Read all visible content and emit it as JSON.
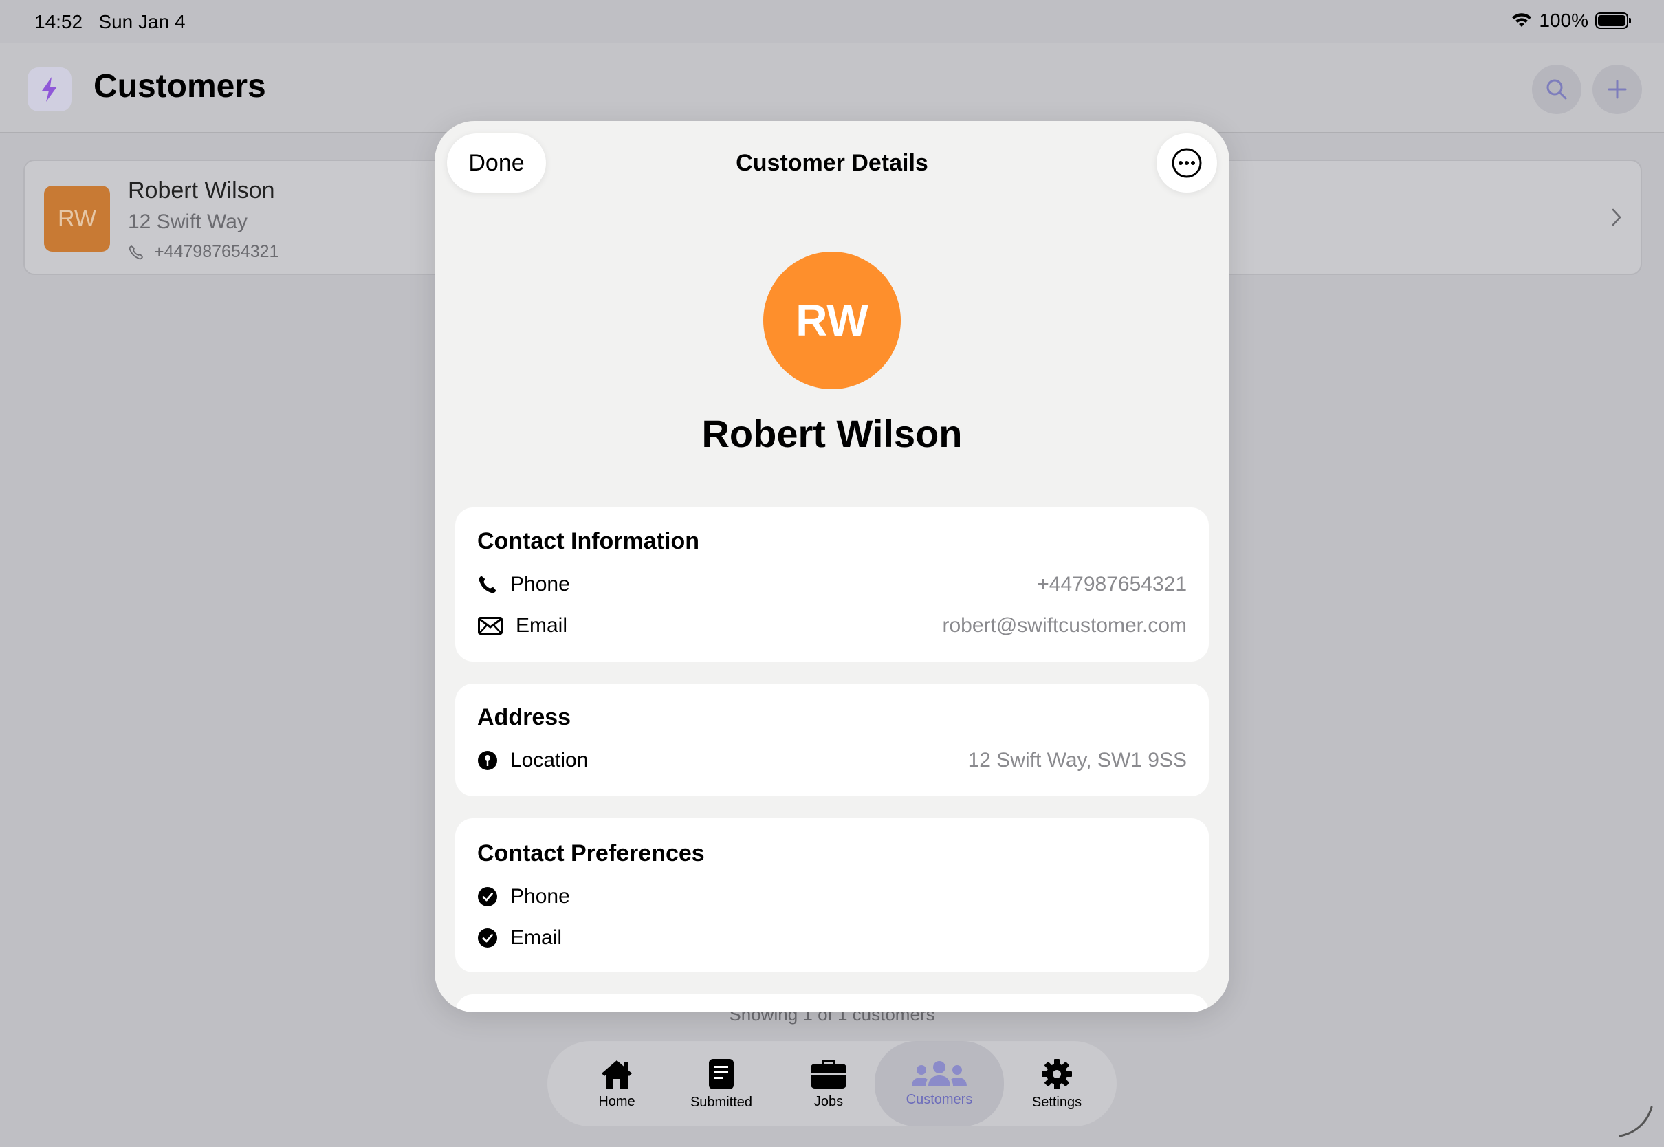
{
  "status_bar": {
    "time": "14:52",
    "date": "Sun Jan 4",
    "battery": "100%"
  },
  "nav": {
    "title": "Customers"
  },
  "customer_row": {
    "initials": "RW",
    "name": "Robert Wilson",
    "street": "12 Swift Way",
    "phone": "+447987654321"
  },
  "footer": {
    "count_text": "Showing 1 of 1 customers"
  },
  "tabs": [
    {
      "label": "Home",
      "icon": "house-icon"
    },
    {
      "label": "Submitted",
      "icon": "document-icon"
    },
    {
      "label": "Jobs",
      "icon": "briefcase-icon"
    },
    {
      "label": "Customers",
      "icon": "people-icon",
      "active": true
    },
    {
      "label": "Settings",
      "icon": "gear-icon"
    }
  ],
  "modal": {
    "done_label": "Done",
    "title": "Customer Details",
    "initials": "RW",
    "name": "Robert Wilson",
    "contact": {
      "title": "Contact Information",
      "phone_label": "Phone",
      "phone_value": "+447987654321",
      "email_label": "Email",
      "email_value": "robert@swiftcustomer.com"
    },
    "address": {
      "title": "Address",
      "location_label": "Location",
      "location_value": "12 Swift Way, SW1 9SS"
    },
    "preferences": {
      "title": "Contact Preferences",
      "items": [
        "Phone",
        "Email"
      ]
    }
  },
  "colors": {
    "avatar_orange": "#fe8f2c",
    "row_avatar": "#c87a34",
    "active_tab_text": "#6c6cbb"
  }
}
